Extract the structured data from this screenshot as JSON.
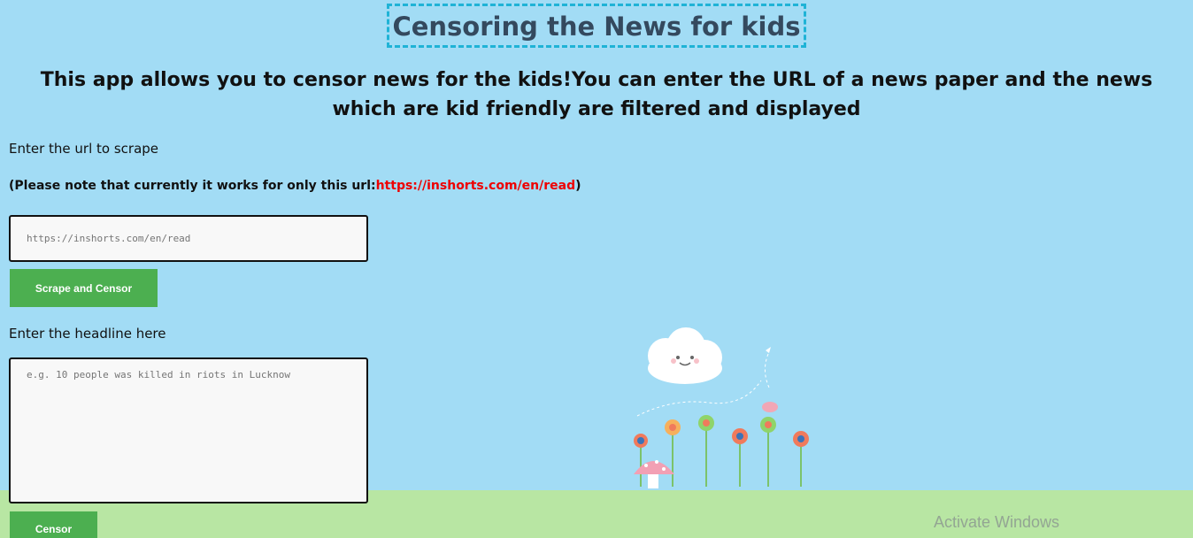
{
  "header": {
    "title": "Censoring the News for kids"
  },
  "intro": {
    "text": "This app allows you to censor news for the kids!You can enter the URL of a news paper and the news which are kid friendly are filtered and displayed"
  },
  "url_section": {
    "label": "Enter the url to scrape",
    "note_prefix": "(Please note that currently it works for only this url:",
    "note_link": "https://inshorts.com/en/read",
    "note_suffix": ")",
    "input_placeholder": "https://inshorts.com/en/read",
    "button_label": "Scrape and Censor"
  },
  "headline_section": {
    "label": "Enter the headline here",
    "input_placeholder": "e.g. 10 people was killed in riots in Lucknow",
    "button_label": "Censor"
  },
  "os_overlay": {
    "watermark": "Activate Windows"
  },
  "decor": {
    "illustration": "cloud-flowers-mushroom-illustration"
  },
  "colors": {
    "background": "#a2dcf5",
    "grass": "#b8e6a3",
    "button": "#4caf50",
    "title_border": "#1fb3d6",
    "link": "#ee0000"
  }
}
